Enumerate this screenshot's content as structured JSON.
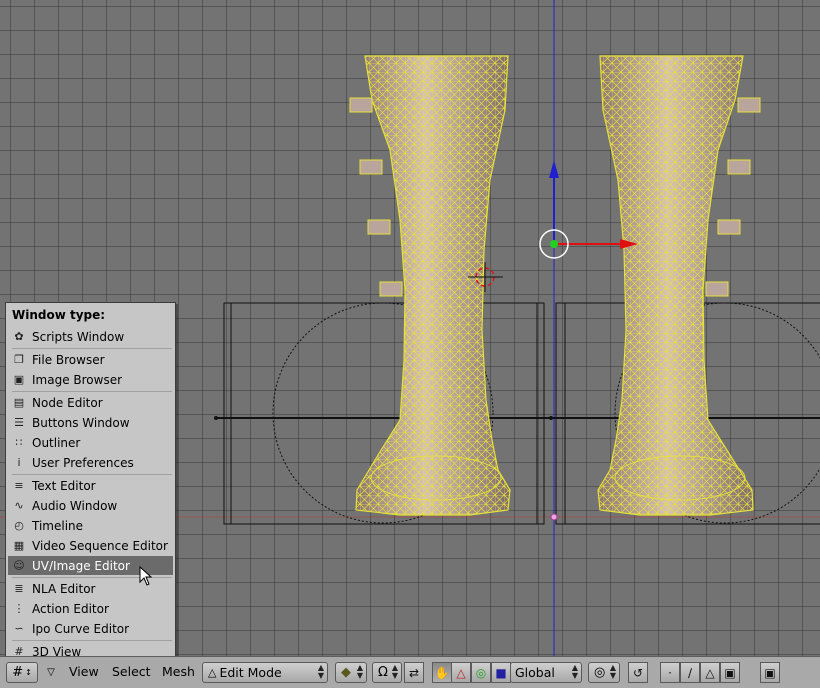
{
  "window_menu": {
    "title": "Window type:",
    "items": [
      {
        "label": "Scripts Window",
        "icon": "scripts-icon",
        "glyph": "✿"
      },
      {
        "label": "File Browser",
        "icon": "file-browser-icon",
        "glyph": "❐"
      },
      {
        "label": "Image Browser",
        "icon": "image-browser-icon",
        "glyph": "▣"
      },
      {
        "label": "Node Editor",
        "icon": "node-editor-icon",
        "glyph": "▤"
      },
      {
        "label": "Buttons Window",
        "icon": "buttons-window-icon",
        "glyph": "☰"
      },
      {
        "label": "Outliner",
        "icon": "outliner-icon",
        "glyph": "∷"
      },
      {
        "label": "User Preferences",
        "icon": "user-preferences-icon",
        "glyph": "i"
      },
      {
        "label": "Text Editor",
        "icon": "text-editor-icon",
        "glyph": "≡"
      },
      {
        "label": "Audio Window",
        "icon": "audio-window-icon",
        "glyph": "∿"
      },
      {
        "label": "Timeline",
        "icon": "timeline-icon",
        "glyph": "◴"
      },
      {
        "label": "Video Sequence Editor",
        "icon": "sequence-editor-icon",
        "glyph": "▦"
      },
      {
        "label": "UV/Image Editor",
        "icon": "uv-image-editor-icon",
        "glyph": "☺"
      },
      {
        "label": "NLA Editor",
        "icon": "nla-editor-icon",
        "glyph": "≣"
      },
      {
        "label": "Action Editor",
        "icon": "action-editor-icon",
        "glyph": "⋮"
      },
      {
        "label": "Ipo Curve Editor",
        "icon": "ipo-curve-editor-icon",
        "glyph": "∽"
      },
      {
        "label": "3D View",
        "icon": "3d-view-icon",
        "glyph": "#"
      }
    ],
    "selected": "UV/Image Editor"
  },
  "header": {
    "menus": [
      "View",
      "Select",
      "Mesh"
    ],
    "mode": "Edit Mode",
    "orientation": "Global"
  },
  "colors": {
    "viewport_bg": "#737373",
    "wireframe": "#d9d43a",
    "axis_blue": "#2020d0",
    "axis_red": "#e01010",
    "menu_bg": "#c6c6c6",
    "menu_selected": "#6b6b6b"
  }
}
